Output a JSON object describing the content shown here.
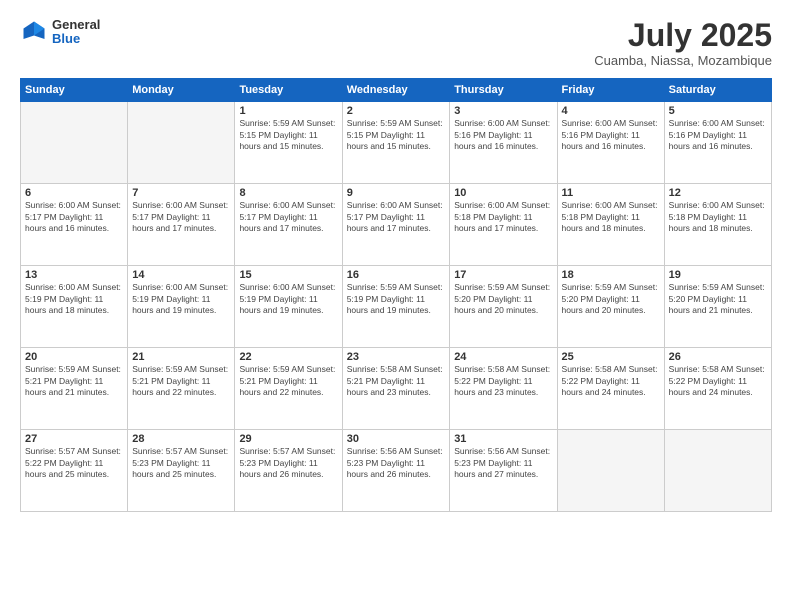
{
  "logo": {
    "general": "General",
    "blue": "Blue"
  },
  "header": {
    "month": "July 2025",
    "location": "Cuamba, Niassa, Mozambique"
  },
  "weekdays": [
    "Sunday",
    "Monday",
    "Tuesday",
    "Wednesday",
    "Thursday",
    "Friday",
    "Saturday"
  ],
  "weeks": [
    [
      {
        "day": "",
        "detail": ""
      },
      {
        "day": "",
        "detail": ""
      },
      {
        "day": "1",
        "detail": "Sunrise: 5:59 AM\nSunset: 5:15 PM\nDaylight: 11 hours and 15 minutes."
      },
      {
        "day": "2",
        "detail": "Sunrise: 5:59 AM\nSunset: 5:15 PM\nDaylight: 11 hours and 15 minutes."
      },
      {
        "day": "3",
        "detail": "Sunrise: 6:00 AM\nSunset: 5:16 PM\nDaylight: 11 hours and 16 minutes."
      },
      {
        "day": "4",
        "detail": "Sunrise: 6:00 AM\nSunset: 5:16 PM\nDaylight: 11 hours and 16 minutes."
      },
      {
        "day": "5",
        "detail": "Sunrise: 6:00 AM\nSunset: 5:16 PM\nDaylight: 11 hours and 16 minutes."
      }
    ],
    [
      {
        "day": "6",
        "detail": "Sunrise: 6:00 AM\nSunset: 5:17 PM\nDaylight: 11 hours and 16 minutes."
      },
      {
        "day": "7",
        "detail": "Sunrise: 6:00 AM\nSunset: 5:17 PM\nDaylight: 11 hours and 17 minutes."
      },
      {
        "day": "8",
        "detail": "Sunrise: 6:00 AM\nSunset: 5:17 PM\nDaylight: 11 hours and 17 minutes."
      },
      {
        "day": "9",
        "detail": "Sunrise: 6:00 AM\nSunset: 5:17 PM\nDaylight: 11 hours and 17 minutes."
      },
      {
        "day": "10",
        "detail": "Sunrise: 6:00 AM\nSunset: 5:18 PM\nDaylight: 11 hours and 17 minutes."
      },
      {
        "day": "11",
        "detail": "Sunrise: 6:00 AM\nSunset: 5:18 PM\nDaylight: 11 hours and 18 minutes."
      },
      {
        "day": "12",
        "detail": "Sunrise: 6:00 AM\nSunset: 5:18 PM\nDaylight: 11 hours and 18 minutes."
      }
    ],
    [
      {
        "day": "13",
        "detail": "Sunrise: 6:00 AM\nSunset: 5:19 PM\nDaylight: 11 hours and 18 minutes."
      },
      {
        "day": "14",
        "detail": "Sunrise: 6:00 AM\nSunset: 5:19 PM\nDaylight: 11 hours and 19 minutes."
      },
      {
        "day": "15",
        "detail": "Sunrise: 6:00 AM\nSunset: 5:19 PM\nDaylight: 11 hours and 19 minutes."
      },
      {
        "day": "16",
        "detail": "Sunrise: 5:59 AM\nSunset: 5:19 PM\nDaylight: 11 hours and 19 minutes."
      },
      {
        "day": "17",
        "detail": "Sunrise: 5:59 AM\nSunset: 5:20 PM\nDaylight: 11 hours and 20 minutes."
      },
      {
        "day": "18",
        "detail": "Sunrise: 5:59 AM\nSunset: 5:20 PM\nDaylight: 11 hours and 20 minutes."
      },
      {
        "day": "19",
        "detail": "Sunrise: 5:59 AM\nSunset: 5:20 PM\nDaylight: 11 hours and 21 minutes."
      }
    ],
    [
      {
        "day": "20",
        "detail": "Sunrise: 5:59 AM\nSunset: 5:21 PM\nDaylight: 11 hours and 21 minutes."
      },
      {
        "day": "21",
        "detail": "Sunrise: 5:59 AM\nSunset: 5:21 PM\nDaylight: 11 hours and 22 minutes."
      },
      {
        "day": "22",
        "detail": "Sunrise: 5:59 AM\nSunset: 5:21 PM\nDaylight: 11 hours and 22 minutes."
      },
      {
        "day": "23",
        "detail": "Sunrise: 5:58 AM\nSunset: 5:21 PM\nDaylight: 11 hours and 23 minutes."
      },
      {
        "day": "24",
        "detail": "Sunrise: 5:58 AM\nSunset: 5:22 PM\nDaylight: 11 hours and 23 minutes."
      },
      {
        "day": "25",
        "detail": "Sunrise: 5:58 AM\nSunset: 5:22 PM\nDaylight: 11 hours and 24 minutes."
      },
      {
        "day": "26",
        "detail": "Sunrise: 5:58 AM\nSunset: 5:22 PM\nDaylight: 11 hours and 24 minutes."
      }
    ],
    [
      {
        "day": "27",
        "detail": "Sunrise: 5:57 AM\nSunset: 5:22 PM\nDaylight: 11 hours and 25 minutes."
      },
      {
        "day": "28",
        "detail": "Sunrise: 5:57 AM\nSunset: 5:23 PM\nDaylight: 11 hours and 25 minutes."
      },
      {
        "day": "29",
        "detail": "Sunrise: 5:57 AM\nSunset: 5:23 PM\nDaylight: 11 hours and 26 minutes."
      },
      {
        "day": "30",
        "detail": "Sunrise: 5:56 AM\nSunset: 5:23 PM\nDaylight: 11 hours and 26 minutes."
      },
      {
        "day": "31",
        "detail": "Sunrise: 5:56 AM\nSunset: 5:23 PM\nDaylight: 11 hours and 27 minutes."
      },
      {
        "day": "",
        "detail": ""
      },
      {
        "day": "",
        "detail": ""
      }
    ]
  ]
}
